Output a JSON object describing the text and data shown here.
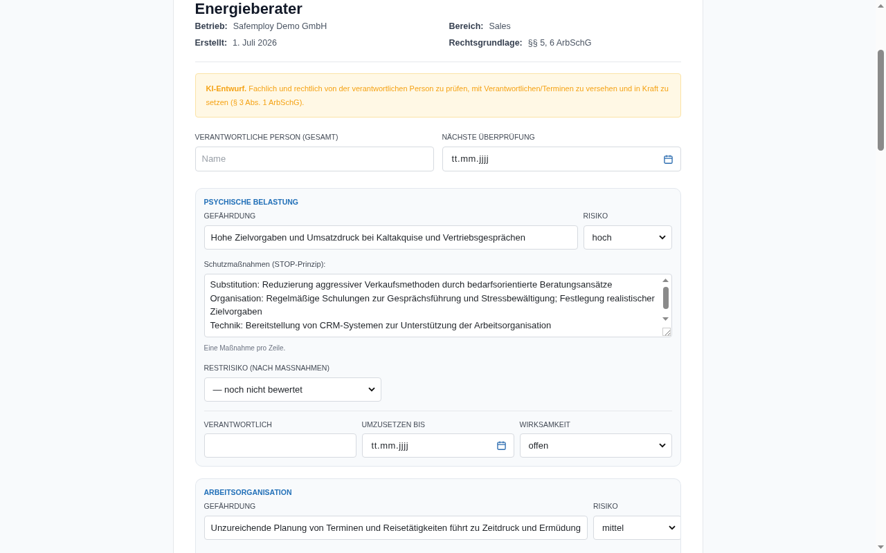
{
  "document": {
    "title": "Energieberater",
    "meta": [
      {
        "label": "Betrieb:",
        "value": "Safemploy Demo GmbH"
      },
      {
        "label": "Bereich:",
        "value": "Sales"
      },
      {
        "label": "Erstellt:",
        "value": "1. Juli 2026"
      },
      {
        "label": "Rechtsgrundlage:",
        "value": "§§ 5, 6 ArbSchG"
      }
    ]
  },
  "notice": {
    "text": "**KI-Entwurf.** Fachlich und rechtlich von der verantwortlichen Person zu prüfen, mit Verantwortlichen/Terminen zu versehen und in Kraft zu setzen (§ 3 Abs. 1 ArbSchG)."
  },
  "general_fields": [
    {
      "kind": "text",
      "label": "VERANTWORTLICHE PERSON (GESAMT)",
      "placeholder": "Name"
    },
    {
      "kind": "date",
      "label": "NÄCHSTE ÜBERPRÜFUNG",
      "placeholder": "tt.mm.jjjj"
    }
  ],
  "sections": [
    {
      "title": "PSYCHISCHE BELASTUNG",
      "hazard": {
        "kind": "text",
        "label": "GEFÄHRDUNG",
        "value": "Hohe Zielvorgaben und Umsatzdruck bei Kaltakquise und Vertriebsgesprächen"
      },
      "risk": {
        "kind": "select",
        "label": "RISIKO",
        "value": "hoch"
      },
      "measures": {
        "label": "Schutzmaßnahmen (STOP-Prinzip):",
        "lines": [
          "Substitution: Reduzierung aggressiver Verkaufsmethoden durch bedarfsorientierte Beratungsansätze",
          "Organisation: Regelmäßige Schulungen zur Gesprächsführung und Stressbewältigung; Festlegung realistischer Zielvorgaben",
          "Technik: Bereitstellung von CRM-Systemen zur Unterstützung der Arbeitsorganisation"
        ],
        "hint": "Eine Maßnahme pro Zeile."
      },
      "residual_risk": {
        "kind": "select",
        "label": "RESTRISIKO (NACH MASSNAHMEN)",
        "value": "— noch nicht bewertet"
      },
      "assignment": [
        {
          "kind": "text",
          "label": "VERANTWORTLICH"
        },
        {
          "kind": "date",
          "label": "UMZUSETZEN BIS",
          "placeholder": "tt.mm.jjjj"
        },
        {
          "kind": "select",
          "label": "WIRKSAMKEIT",
          "value": "offen"
        }
      ]
    },
    {
      "title": "ARBEITSORGANISATION",
      "hazard": {
        "kind": "text",
        "label": "GEFÄHRDUNG",
        "value": "Unzureichende Planung von Terminen und Reisetätigkeiten führt zu Zeitdruck und Ermüdung"
      },
      "risk": {
        "kind": "select",
        "label": "RISIKO",
        "value": "mittel"
      }
    }
  ]
}
